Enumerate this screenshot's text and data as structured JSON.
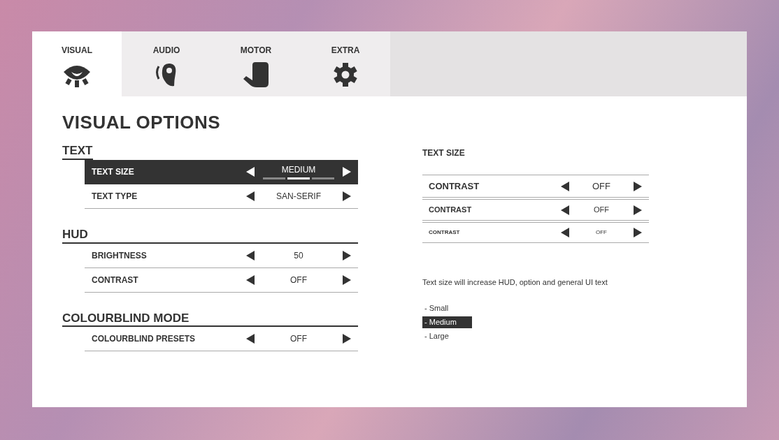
{
  "tabs": [
    {
      "label": "VISUAL",
      "selected": true
    },
    {
      "label": "AUDIO",
      "selected": false
    },
    {
      "label": "MOTOR",
      "selected": false
    },
    {
      "label": "EXTRA",
      "selected": false
    }
  ],
  "title": "VISUAL OPTIONS",
  "sections": [
    {
      "heading": "TEXT",
      "rows": [
        {
          "label": "TEXT SIZE",
          "value": "MEDIUM",
          "selected": true,
          "steps": [
            {
              "selected": false
            },
            {
              "selected": true
            },
            {
              "selected": false
            }
          ]
        },
        {
          "label": "TEXT TYPE",
          "value": "SAN-SERIF",
          "selected": false
        }
      ]
    },
    {
      "heading": "HUD",
      "rows": [
        {
          "label": "BRIGHTNESS",
          "value": "50",
          "selected": false
        },
        {
          "label": "CONTRAST",
          "value": "OFF",
          "selected": false
        }
      ]
    },
    {
      "heading": "COLOURBLIND MODE",
      "rows": [
        {
          "label": "COLOURBLIND PRESETS",
          "value": "OFF",
          "selected": false
        }
      ]
    }
  ],
  "preview": {
    "heading": "TEXT SIZE",
    "rows": [
      {
        "label": "CONTRAST",
        "value": "OFF",
        "kind": "large"
      },
      {
        "label": "CONTRAST",
        "value": "OFF",
        "kind": "medium"
      },
      {
        "label": "CONTRAST",
        "value": "OFF",
        "kind": "small"
      }
    ],
    "description": "Text size will increase HUD, option and general UI text",
    "options": [
      {
        "label": "- Small",
        "selected": false
      },
      {
        "label": "- Medium",
        "selected": true
      },
      {
        "label": "- Large",
        "selected": false
      }
    ]
  }
}
